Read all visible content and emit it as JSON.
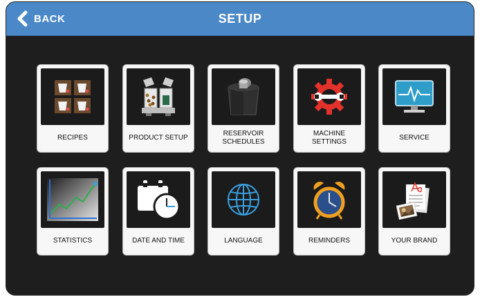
{
  "header": {
    "back_label": "BACK",
    "title": "SETUP"
  },
  "tiles": [
    {
      "label": "RECIPES",
      "icon": "recipes-icon"
    },
    {
      "label": "PRODUCT SETUP",
      "icon": "product-setup-icon"
    },
    {
      "label": "RESERVOIR\nSCHEDULES",
      "icon": "reservoir-icon"
    },
    {
      "label": "MACHINE\nSETTINGS",
      "icon": "gear-wrench-icon"
    },
    {
      "label": "SERVICE",
      "icon": "monitor-pulse-icon"
    },
    {
      "label": "STATISTICS",
      "icon": "line-chart-icon"
    },
    {
      "label": "DATE AND TIME",
      "icon": "calendar-clock-icon"
    },
    {
      "label": "LANGUAGE",
      "icon": "globe-icon"
    },
    {
      "label": "REMINDERS",
      "icon": "alarm-clock-icon"
    },
    {
      "label": "YOUR BRAND",
      "icon": "brand-documents-icon"
    }
  ],
  "colors": {
    "header": "#4a88c7",
    "background": "#1e1e1e",
    "accent_red": "#e2322b",
    "accent_blue": "#3aa0e0",
    "accent_orange": "#f0a020"
  }
}
